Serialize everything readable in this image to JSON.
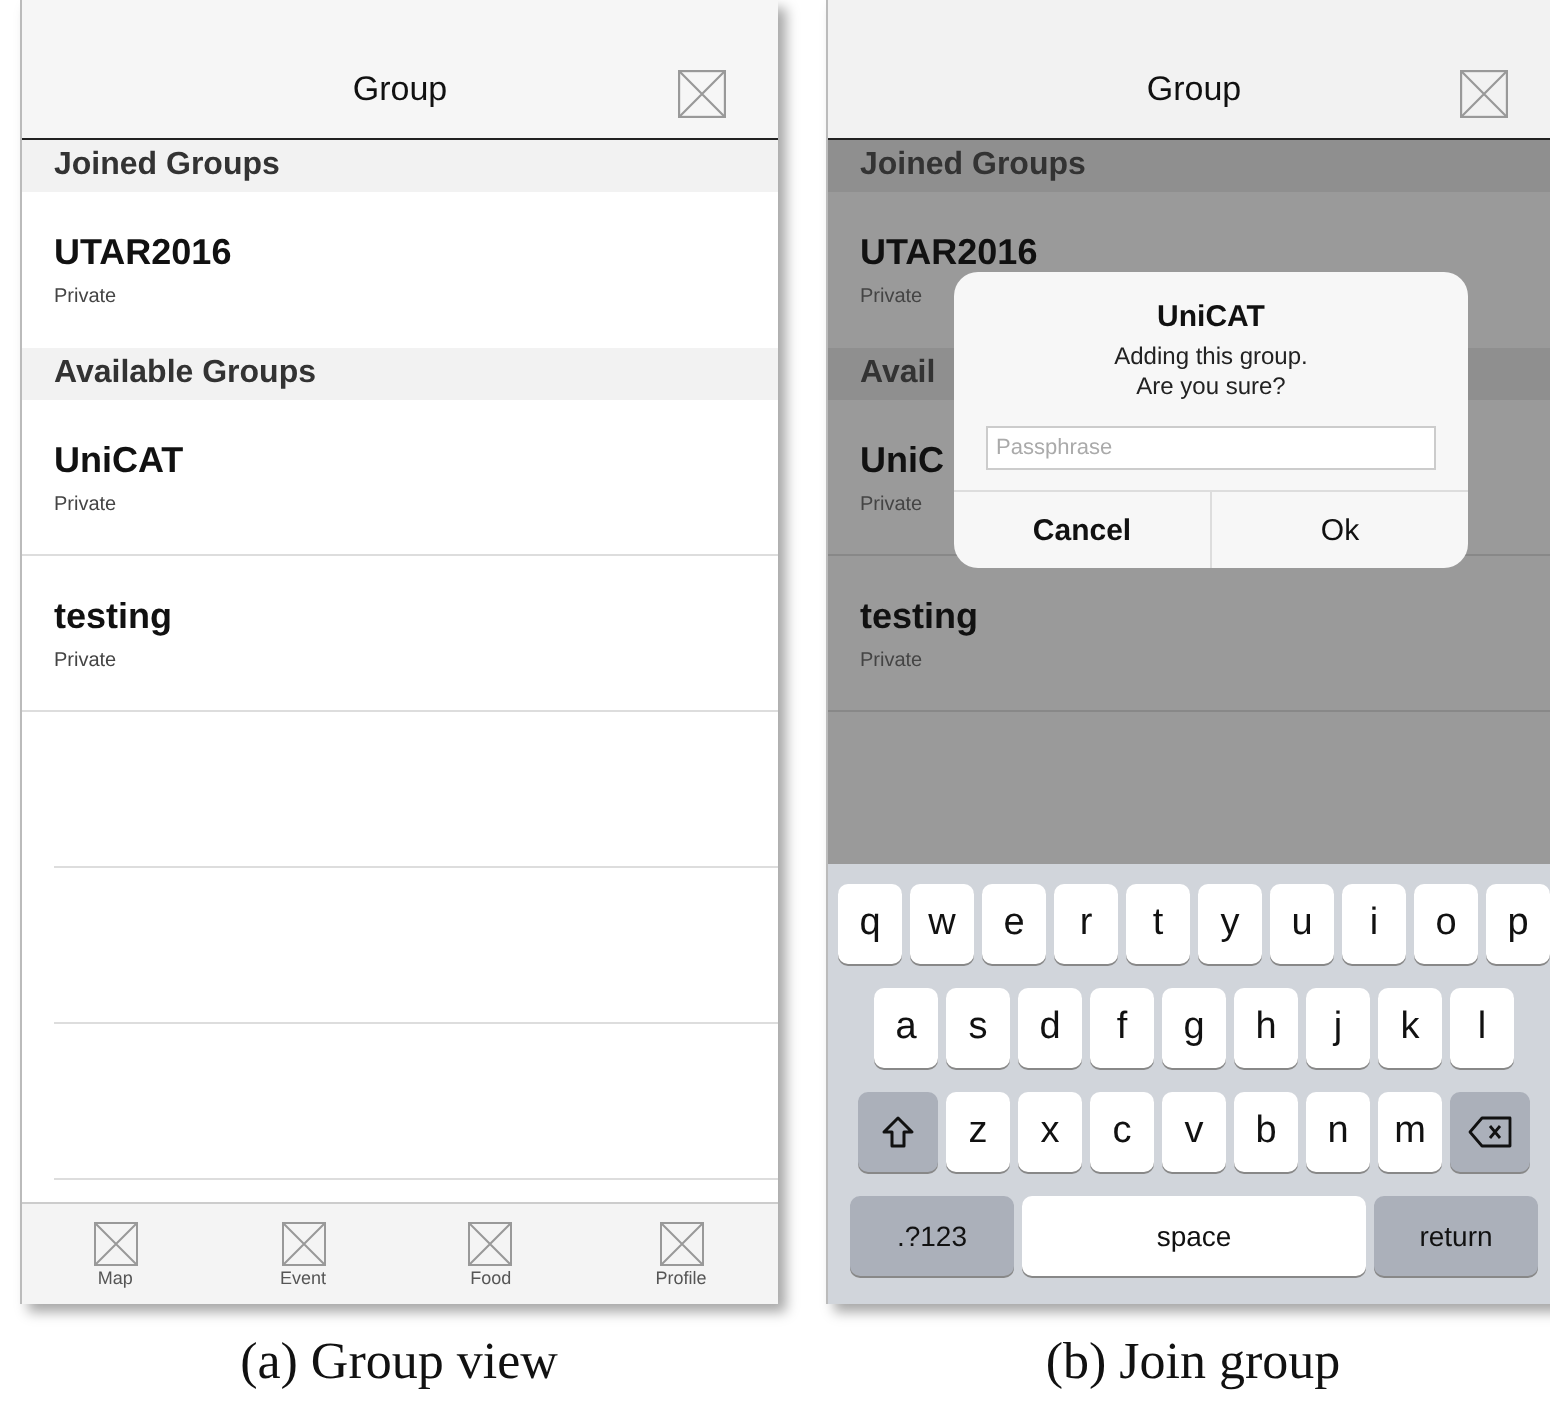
{
  "panels": [
    {
      "caption": "(a) Group view",
      "dimmed": false,
      "header": {
        "title": "Group"
      },
      "sections": [
        {
          "title": "Joined Groups",
          "rows": [
            {
              "name": "UTAR2016",
              "privacy": "Private"
            }
          ]
        },
        {
          "title": "Available Groups",
          "rows": [
            {
              "name": "UniCAT",
              "privacy": "Private"
            },
            {
              "name": "testing",
              "privacy": "Private"
            }
          ]
        }
      ],
      "tab_bar": [
        "Map",
        "Event",
        "Food",
        "Profile"
      ]
    },
    {
      "caption": "(b) Join group",
      "dimmed": true,
      "header": {
        "title": "Group"
      },
      "sections": [
        {
          "title": "Joined Groups",
          "rows": [
            {
              "name": "UTAR2016",
              "privacy": "Private"
            }
          ]
        },
        {
          "title": "Avail",
          "rows": [
            {
              "name": "UniC",
              "privacy": "Private"
            },
            {
              "name": "testing",
              "privacy": "Private"
            }
          ]
        }
      ],
      "dialog": {
        "title": "UniCAT",
        "message_lines": [
          "Adding this group.",
          "Are you sure?"
        ],
        "placeholder": "Passphrase",
        "buttons": [
          "Cancel",
          "Ok"
        ]
      },
      "keyboard": [
        [
          {
            "kind": "letter",
            "label": "q"
          },
          {
            "kind": "letter",
            "label": "w"
          },
          {
            "kind": "letter",
            "label": "e"
          },
          {
            "kind": "letter",
            "label": "r"
          },
          {
            "kind": "letter",
            "label": "t"
          },
          {
            "kind": "letter",
            "label": "y"
          },
          {
            "kind": "letter",
            "label": "u"
          },
          {
            "kind": "letter",
            "label": "i"
          },
          {
            "kind": "letter",
            "label": "o"
          },
          {
            "kind": "letter",
            "label": "p"
          }
        ],
        [
          {
            "kind": "letter",
            "label": "a"
          },
          {
            "kind": "letter",
            "label": "s"
          },
          {
            "kind": "letter",
            "label": "d"
          },
          {
            "kind": "letter",
            "label": "f"
          },
          {
            "kind": "letter",
            "label": "g"
          },
          {
            "kind": "letter",
            "label": "h"
          },
          {
            "kind": "letter",
            "label": "j"
          },
          {
            "kind": "letter",
            "label": "k"
          },
          {
            "kind": "letter",
            "label": "l"
          }
        ],
        [
          {
            "kind": "shift"
          },
          {
            "kind": "letter",
            "label": "z"
          },
          {
            "kind": "letter",
            "label": "x"
          },
          {
            "kind": "letter",
            "label": "c"
          },
          {
            "kind": "letter",
            "label": "v"
          },
          {
            "kind": "letter",
            "label": "b"
          },
          {
            "kind": "letter",
            "label": "n"
          },
          {
            "kind": "letter",
            "label": "m"
          },
          {
            "kind": "delete"
          }
        ],
        [
          {
            "kind": "function",
            "label": ".?123"
          },
          {
            "kind": "space",
            "label": "space"
          },
          {
            "kind": "function",
            "label": "return"
          }
        ]
      ]
    }
  ]
}
